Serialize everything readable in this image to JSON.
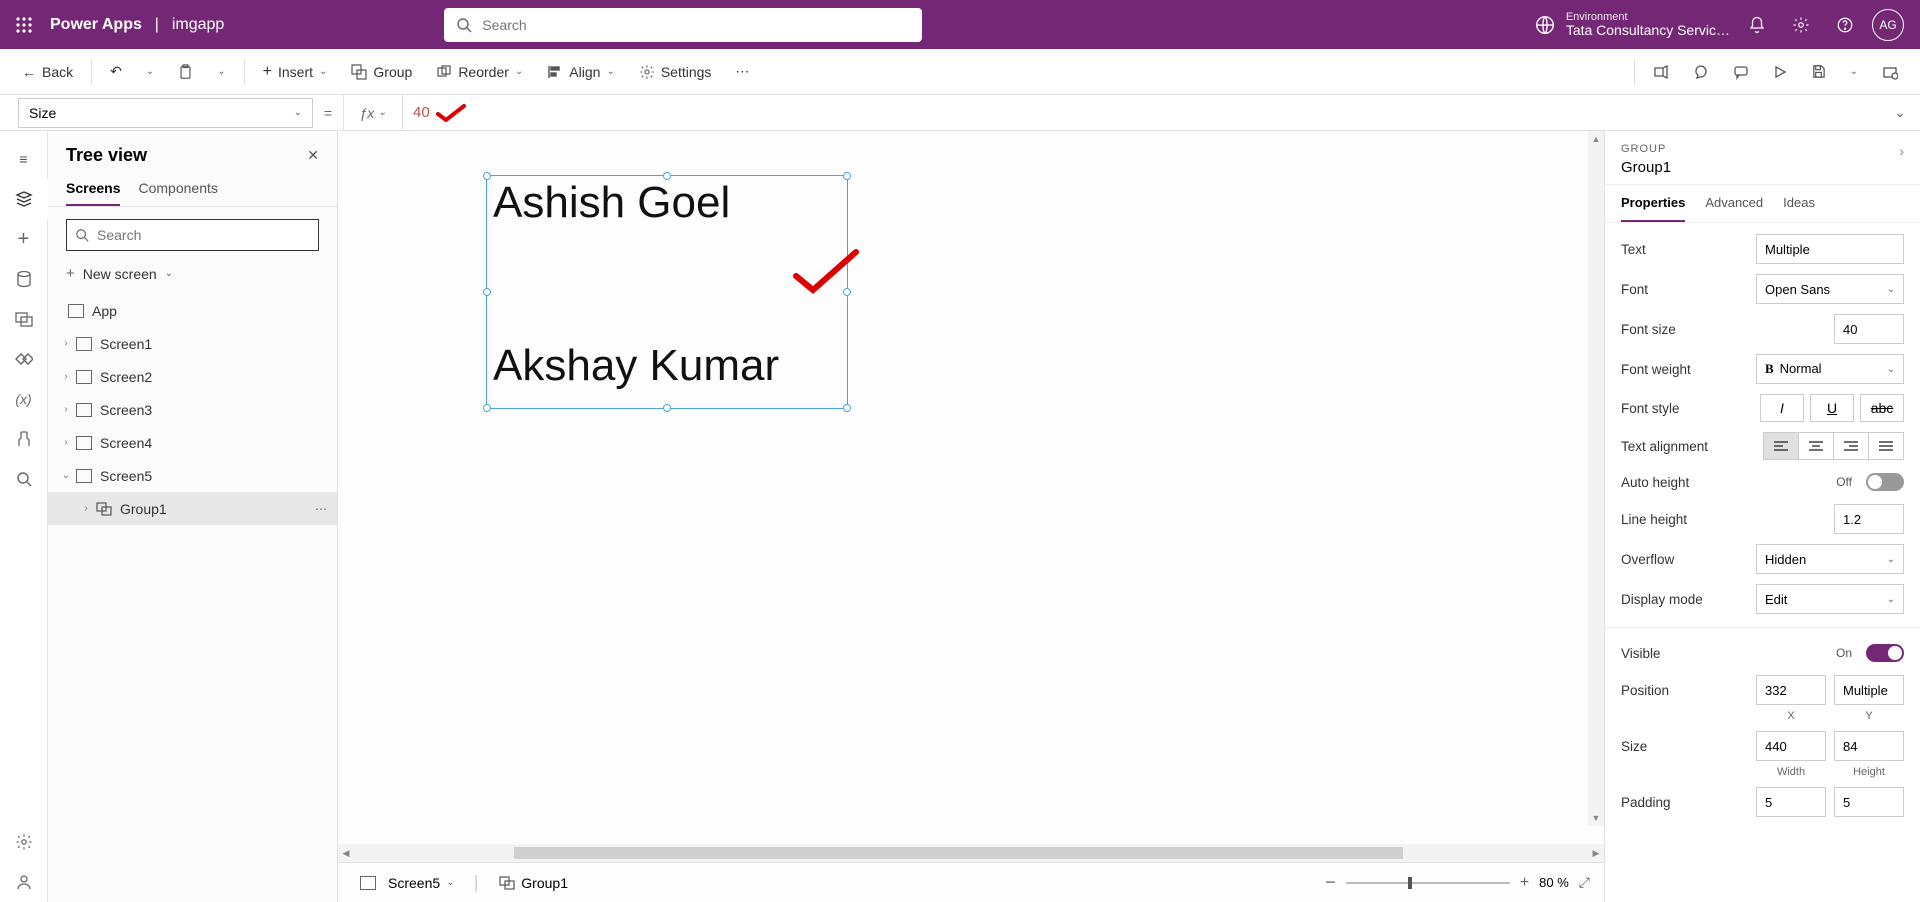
{
  "topbar": {
    "brand": "Power Apps",
    "appName": "imgapp",
    "searchPlaceholder": "Search",
    "envLabel": "Environment",
    "envValue": "Tata Consultancy Servic…",
    "avatar": "AG"
  },
  "cmdbar": {
    "back": "Back",
    "insert": "Insert",
    "group": "Group",
    "reorder": "Reorder",
    "align": "Align",
    "settings": "Settings"
  },
  "formula": {
    "property": "Size",
    "value": "40"
  },
  "tree": {
    "title": "Tree view",
    "tabs": {
      "screens": "Screens",
      "components": "Components"
    },
    "searchPlaceholder": "Search",
    "newScreen": "New screen",
    "app": "App",
    "screens": [
      "Screen1",
      "Screen2",
      "Screen3",
      "Screen4",
      "Screen5"
    ],
    "group": "Group1"
  },
  "canvas": {
    "text1": "Ashish Goel",
    "text2": "Akshay Kumar",
    "breadcrumbScreen": "Screen5",
    "breadcrumbSel": "Group1",
    "zoom": "80  %"
  },
  "rpane": {
    "type": "GROUP",
    "name": "Group1",
    "tabs": {
      "properties": "Properties",
      "advanced": "Advanced",
      "ideas": "Ideas"
    },
    "props": {
      "textLabel": "Text",
      "textValue": "Multiple",
      "fontLabel": "Font",
      "fontValue": "Open Sans",
      "fontSizeLabel": "Font size",
      "fontSizeValue": "40",
      "fontWeightLabel": "Font weight",
      "fontWeightValue": "Normal",
      "fontStyleLabel": "Font style",
      "textAlignLabel": "Text alignment",
      "autoHeightLabel": "Auto height",
      "autoHeightValue": "Off",
      "lineHeightLabel": "Line height",
      "lineHeightValue": "1.2",
      "overflowLabel": "Overflow",
      "overflowValue": "Hidden",
      "displayModeLabel": "Display mode",
      "displayModeValue": "Edit",
      "visibleLabel": "Visible",
      "visibleValue": "On",
      "positionLabel": "Position",
      "positionX": "332",
      "positionY": "Multiple",
      "xLabel": "X",
      "yLabel": "Y",
      "sizeLabel": "Size",
      "sizeW": "440",
      "sizeH": "84",
      "wLabel": "Width",
      "hLabel": "Height",
      "paddingLabel": "Padding",
      "padA": "5",
      "padB": "5"
    }
  }
}
